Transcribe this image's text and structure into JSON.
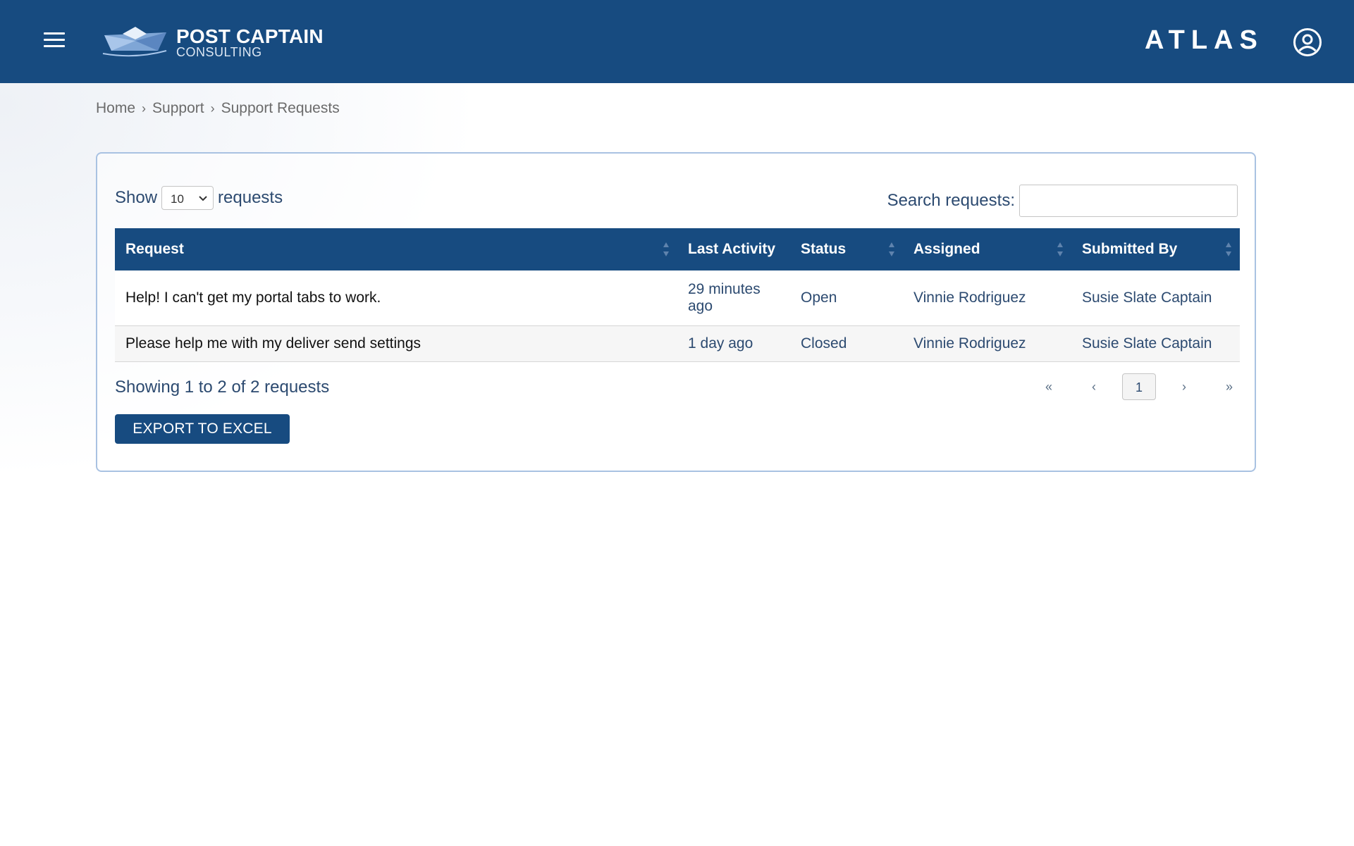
{
  "header": {
    "logo_title": "POST CAPTAIN",
    "logo_subtitle": "CONSULTING",
    "brand": "ATLAS"
  },
  "breadcrumb": [
    "Home",
    "Support",
    "Support Requests"
  ],
  "controls": {
    "show_label": "Show",
    "show_value": "10",
    "show_suffix": "requests",
    "search_label": "Search requests:",
    "search_value": ""
  },
  "table": {
    "columns": [
      "Request",
      "Last Activity",
      "Status",
      "Assigned",
      "Submitted By"
    ],
    "rows": [
      {
        "request": "Help! I can't get my portal tabs to work.",
        "last_activity": "29 minutes ago",
        "status": "Open",
        "assigned": "Vinnie Rodriguez",
        "submitted_by": "Susie Slate Captain"
      },
      {
        "request": "Please help me with my deliver send settings",
        "last_activity": "1 day ago",
        "status": "Closed",
        "assigned": "Vinnie Rodriguez",
        "submitted_by": "Susie Slate Captain"
      }
    ]
  },
  "footer": {
    "showing_text": "Showing 1 to 2 of 2 requests",
    "export_label": "EXPORT TO EXCEL"
  },
  "pagination": {
    "first": "«",
    "prev": "‹",
    "current": "1",
    "next": "›",
    "last": "»"
  },
  "colors": {
    "primary": "#174b80",
    "panel_border": "#a9c2e2",
    "text": "#2c4a70"
  }
}
